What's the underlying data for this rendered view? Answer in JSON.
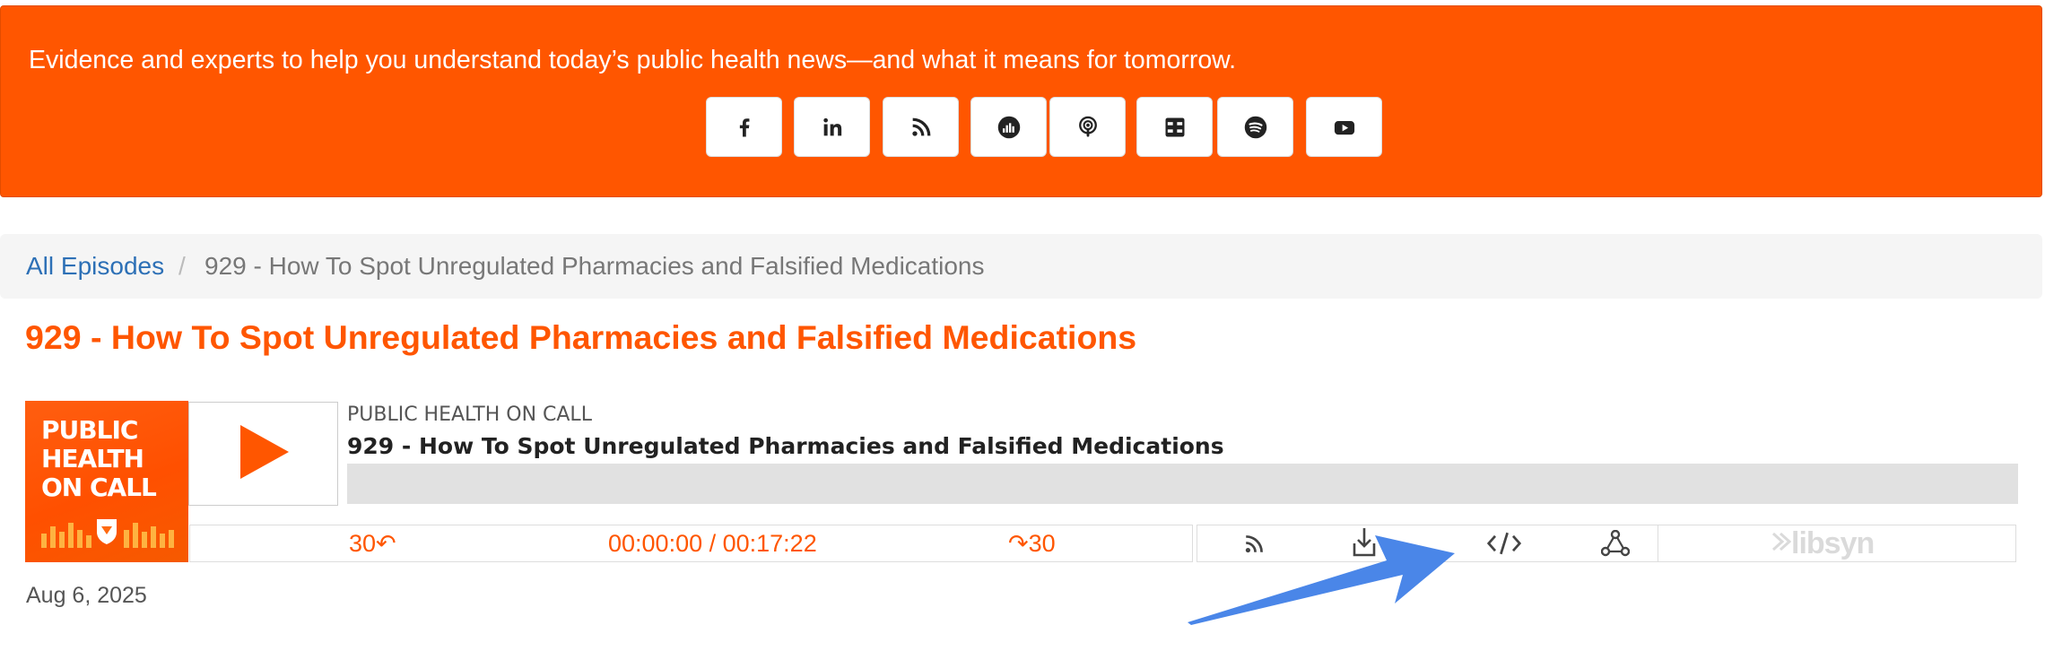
{
  "banner": {
    "tagline": "Evidence and experts to help you understand today’s public health news—and what it means for tomorrow.",
    "social_links": [
      {
        "name": "facebook",
        "icon": "facebook-icon"
      },
      {
        "name": "linkedin",
        "icon": "linkedin-icon"
      },
      {
        "name": "rss",
        "icon": "rss-icon"
      },
      {
        "name": "deezer",
        "icon": "deezer-icon"
      },
      {
        "name": "apple-podcasts",
        "icon": "podcast-icon"
      },
      {
        "name": "podcast-app",
        "icon": "podcast-app-icon"
      },
      {
        "name": "spotify",
        "icon": "spotify-icon"
      },
      {
        "name": "youtube",
        "icon": "youtube-icon"
      }
    ],
    "background_color": "#ff5600"
  },
  "breadcrumb": {
    "root_label": "All Episodes",
    "separator": "/",
    "current": "929 - How To Spot Unregulated Pharmacies and Falsified Medications"
  },
  "episode": {
    "title": "929 - How To Spot Unregulated Pharmacies and Falsified Medications",
    "date": "Aug 6, 2025"
  },
  "player": {
    "artwork_text": [
      "PUBLIC",
      "HEALTH",
      "ON CALL"
    ],
    "show_name": "PUBLIC HEALTH ON CALL",
    "episode_title": "929 - How To Spot Unregulated Pharmacies and Falsified Medications",
    "progress_fraction": 0,
    "rewind_label": "30↶",
    "forward_label": "↷30",
    "time": "00:00:00 / 00:17:22",
    "controls": [
      "rss-icon",
      "download-icon",
      "embed-code-icon",
      "share-icon"
    ],
    "brand": "libsyn",
    "accent_color": "#ff5600"
  },
  "annotation": {
    "color": "#4a86e8"
  }
}
